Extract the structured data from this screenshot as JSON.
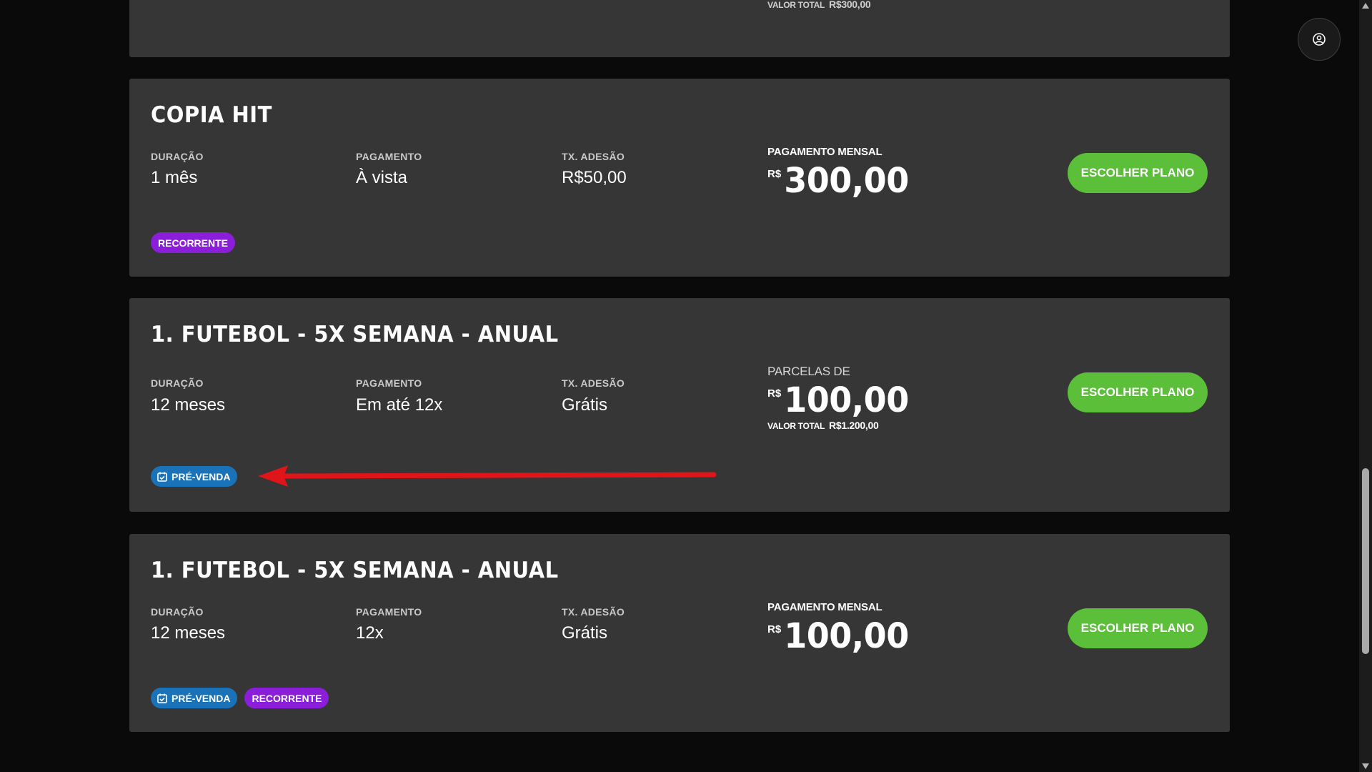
{
  "top_card": {
    "total_label": "VALOR TOTAL",
    "total_value": "R$300,00"
  },
  "labels": {
    "duration": "DURAÇÃO",
    "payment": "PAGAMENTO",
    "fee": "TX. ADESÃO",
    "currency": "R$",
    "choose_button": "ESCOLHER PLANO",
    "total_label": "VALOR TOTAL"
  },
  "plans": [
    {
      "title": "COPIA HIT",
      "duration": "1 mês",
      "payment": "À vista",
      "fee": "R$50,00",
      "price_label": "PAGAMENTO MENSAL",
      "price": "300,00",
      "tags": [
        "RECORRENTE"
      ]
    },
    {
      "title": "1. FUTEBOL - 5X SEMANA - ANUAL",
      "duration": "12 meses",
      "payment": "Em até 12x",
      "fee": "Grátis",
      "price_label": "PARCELAS DE",
      "price": "100,00",
      "total_value": "R$1.200,00",
      "tags": [
        "PRÉ-VENDA"
      ]
    },
    {
      "title": "1. FUTEBOL - 5X SEMANA - ANUAL",
      "duration": "12 meses",
      "payment": "12x",
      "fee": "Grátis",
      "price_label": "PAGAMENTO MENSAL",
      "price": "100,00",
      "tags": [
        "PRÉ-VENDA",
        "RECORRENTE"
      ]
    }
  ],
  "colors": {
    "background": "#0a0a0a",
    "card": "#363636",
    "button_green": "#5bbf3a",
    "tag_purple": "#8b1ed8",
    "tag_blue": "#1a73b8",
    "annotation_arrow": "#e0151a"
  },
  "icons": {
    "avatar": "user-circle-icon",
    "presale": "calendar-check-icon",
    "scroll_up": "triangle-up-icon",
    "scroll_down": "triangle-down-icon"
  }
}
